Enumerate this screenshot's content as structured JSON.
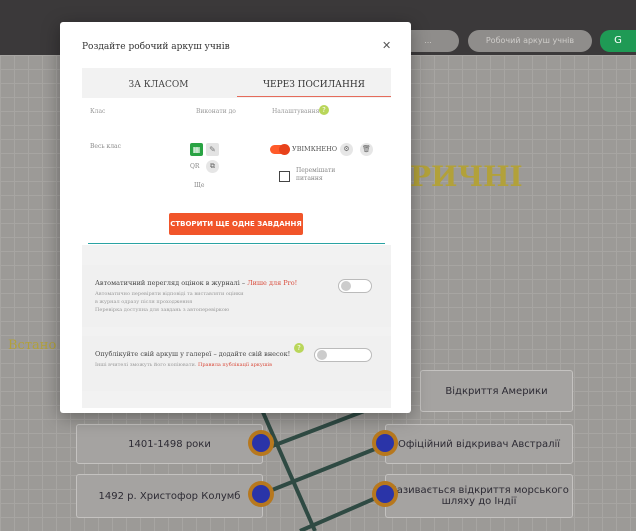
{
  "topbar": {
    "pill_1_label": "...",
    "pill_2_label": "Робочий аркуш учнів",
    "pill_3_icon": "gear-icon",
    "pill_3_label": "G"
  },
  "background": {
    "title_fragment": "РИЧНІ",
    "left_fragment": "Встано",
    "left_cards": [
      "1401-1498 роки",
      "1492 р. Христофор Колумб"
    ],
    "right_cards": [
      "Відкриття Америки",
      "Офіційний відкривач Австралії",
      "Називається відкриття морського шляху до Індії"
    ]
  },
  "modal": {
    "title": "Роздайте робочий аркуш учнів",
    "close_icon": "close-icon",
    "tabs": [
      "ЗА КЛАСОМ",
      "ЧЕРЕЗ ПОСИЛАННЯ"
    ],
    "active_tab": 1,
    "columns": {
      "col1": "Клас",
      "col2": "Виконати до",
      "col3": "Налаштування"
    },
    "row": {
      "class_name": "Весь клас",
      "qr_label": "QR",
      "copy_label": "Копіювати",
      "extra_label": "Ще",
      "toggle_label": "УВІМКНЕНО",
      "checkbox_label": "Перемішати питання"
    },
    "create_button": "СТВОРИТИ ЩЕ ОДНЕ ЗАВДАННЯ",
    "options": [
      {
        "title": "Автоматичний перегляд оцінок в журналі",
        "title_badge": "Лише для Pro!",
        "desc_lines": [
          "Автоматично перевіряти відповіді та виставляти оцінки",
          "в журнал одразу після проходження",
          "Перевірка доступна для завдань з автоперевіркою"
        ]
      },
      {
        "title": "Опублікуйте свій аркуш у галереї – додайте свій внесок!",
        "desc_text": "Інші вчителі зможуть його копіювати.",
        "desc_link": "Правила публікації аркушів"
      }
    ]
  },
  "colors": {
    "accent_orange": "#f1552a",
    "tab_underline": "#e56b5b",
    "divider_teal": "#2aa3a3",
    "status_green": "#1f9a55",
    "help_badge": "#b9d65a"
  }
}
